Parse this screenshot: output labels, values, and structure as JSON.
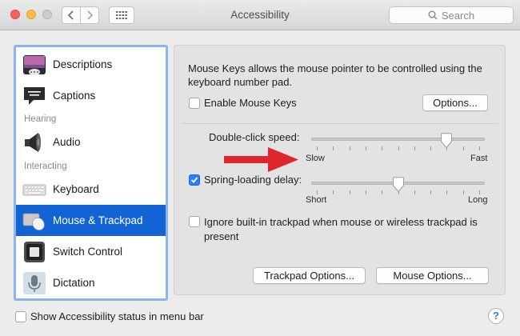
{
  "window": {
    "title": "Accessibility"
  },
  "search": {
    "placeholder": "Search"
  },
  "sidebar": {
    "items": [
      {
        "label": "Descriptions"
      },
      {
        "label": "Captions"
      },
      {
        "label": "Audio"
      },
      {
        "label": "Keyboard"
      },
      {
        "label": "Mouse & Trackpad",
        "selected": true
      },
      {
        "label": "Switch Control"
      },
      {
        "label": "Dictation"
      }
    ],
    "headers": [
      "Hearing",
      "Interacting"
    ]
  },
  "panel": {
    "description": "Mouse Keys allows the mouse pointer to be controlled using the keyboard number pad.",
    "enable_mouse_keys": {
      "label": "Enable Mouse Keys",
      "checked": false
    },
    "options_button": "Options...",
    "double_click": {
      "label": "Double-click speed:",
      "min_label": "Slow",
      "max_label": "Fast",
      "value": 0.8
    },
    "spring_loading": {
      "label": "Spring-loading delay:",
      "checked": true,
      "min_label": "Short",
      "max_label": "Long",
      "value": 0.5
    },
    "ignore_trackpad": {
      "label": "Ignore built-in trackpad when mouse or wireless trackpad is present",
      "checked": false
    },
    "trackpad_options_button": "Trackpad Options...",
    "mouse_options_button": "Mouse Options..."
  },
  "footer": {
    "status_checkbox": {
      "label": "Show Accessibility status in menu bar",
      "checked": false
    },
    "help": "?"
  },
  "colors": {
    "accent": "#1263d4",
    "selection_border": "#8db4f0",
    "annotation_arrow": "#e0262d"
  }
}
